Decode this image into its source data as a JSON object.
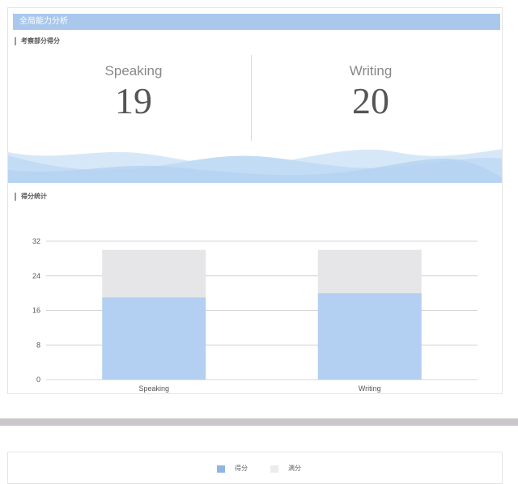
{
  "header": {
    "title": "全局能力分析"
  },
  "sections": {
    "scores_title": "考察部分得分",
    "stats_title": "得分统计"
  },
  "scores": [
    {
      "label": "Speaking",
      "value": "19"
    },
    {
      "label": "Writing",
      "value": "20"
    }
  ],
  "colors": {
    "accent": "#a9c8ec",
    "score_bar": "#b3cff1",
    "full_bar": "#e6e6e8",
    "grid": "#d4d4d4"
  },
  "legend": [
    {
      "label": "得分",
      "color": "#8fb5e6"
    },
    {
      "label": "满分",
      "color": "#ececee"
    }
  ],
  "chart_data": {
    "type": "bar",
    "stacked": true,
    "categories": [
      "Speaking",
      "Writing"
    ],
    "series": [
      {
        "name": "得分",
        "values": [
          19,
          20
        ]
      },
      {
        "name": "满分",
        "values": [
          30,
          30
        ]
      }
    ],
    "yticks": [
      0,
      8,
      16,
      24,
      32
    ],
    "ylim": [
      0,
      32
    ],
    "grid": true,
    "legend_position": "bottom"
  }
}
